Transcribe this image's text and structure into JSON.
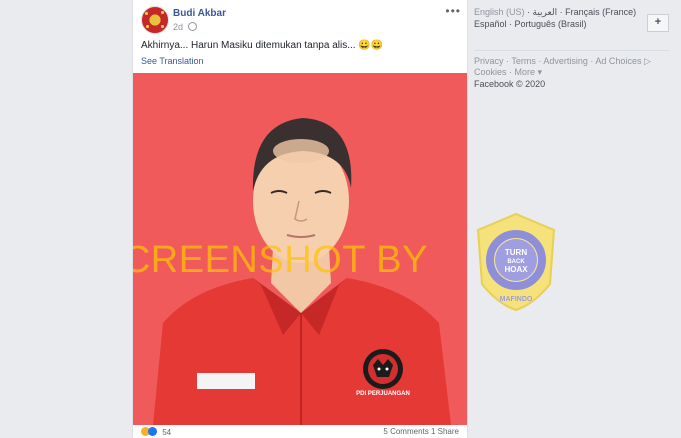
{
  "post": {
    "author": "Budi Akbar",
    "time": "2d",
    "text": "Akhirnya... Harun Masiku ditemukan tanpa alis... 😀😀",
    "see_translation": "See Translation",
    "more": "•••",
    "photo": {
      "watermark": "SCREENSHOT BY",
      "badge_line1": "TURN",
      "badge_line2": "BACK",
      "badge_line3": "HOAX",
      "badge_ring_text": "MASYARAKAT ANTI FITNAH INDONESIA",
      "badge_bottom": "MAFINDO",
      "shirt_logo_text": "PDI PERJUANGAN"
    },
    "reaction_count": "54",
    "stats": "5 Comments   1 Share"
  },
  "sidebar": {
    "languages": {
      "current": "English (US)",
      "others": [
        "العربية",
        "Français (France)",
        "Español",
        "Português (Brasil)"
      ]
    },
    "add_language": "+",
    "links": [
      "Privacy",
      "Terms",
      "Advertising",
      "Ad Choices ▷",
      "Cookies",
      "More ▾"
    ],
    "copyright": "Facebook © 2020"
  },
  "colors": {
    "photo_bg": "#f05a5a",
    "shirt": "#e53935",
    "link_blue": "#385898",
    "watermark": "#ffc107"
  }
}
